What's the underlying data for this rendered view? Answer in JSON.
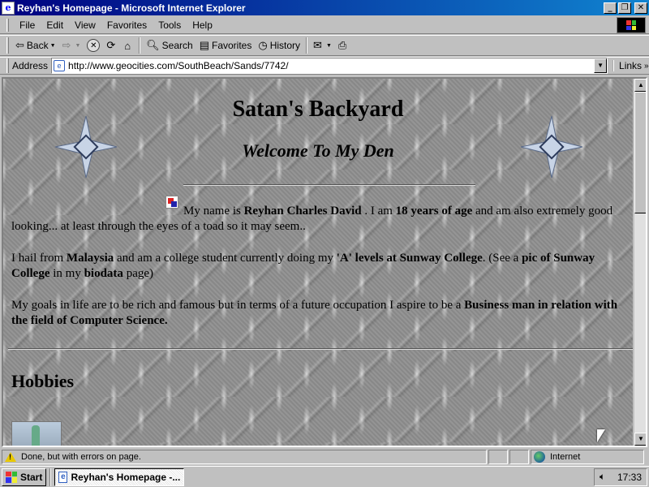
{
  "window": {
    "title": "Reyhan's Homepage - Microsoft Internet Explorer",
    "minimize_glyph": "_",
    "maximize_glyph": "❐",
    "close_glyph": "✕"
  },
  "menu": {
    "items": [
      {
        "label": "File"
      },
      {
        "label": "Edit"
      },
      {
        "label": "View"
      },
      {
        "label": "Favorites"
      },
      {
        "label": "Tools"
      },
      {
        "label": "Help"
      }
    ]
  },
  "toolbar": {
    "back_label": "Back",
    "search_label": "Search",
    "favorites_label": "Favorites",
    "history_label": "History"
  },
  "address": {
    "label": "Address",
    "url": "http://www.geocities.com/SouthBeach/Sands/7742/",
    "links_label": "Links"
  },
  "page": {
    "title": "Satan's Backyard",
    "subtitle": "Welcome To My Den",
    "intro_pre": "My name is ",
    "intro_name": "Reyhan Charles David",
    "intro_mid": " . I am ",
    "intro_age": "18 years of age",
    "intro_post": " and am also extremely good looking... at least through the eyes of a toad so it may seem..",
    "p2_a": "I hail from ",
    "p2_country": "Malaysia",
    "p2_b": " and am a college student currently doing my ",
    "p2_course": "'A' levels at Sunway College",
    "p2_c": ". (See a ",
    "p2_pic": "pic of Sunway College",
    "p2_d": " in my ",
    "p2_biodata": "biodata",
    "p2_e": " page)",
    "p3_a": "My goals in life are to be rich and famous but in terms of a future occupation I aspire to be a ",
    "p3_goal": "Business man in relation with the field of Computer Science.",
    "hobbies_heading": "Hobbies"
  },
  "status": {
    "message": "Done, but with errors on page.",
    "zone": "Internet"
  },
  "taskbar": {
    "start_label": "Start",
    "task_label": "Reyhan's Homepage -...",
    "clock": "17:33"
  }
}
